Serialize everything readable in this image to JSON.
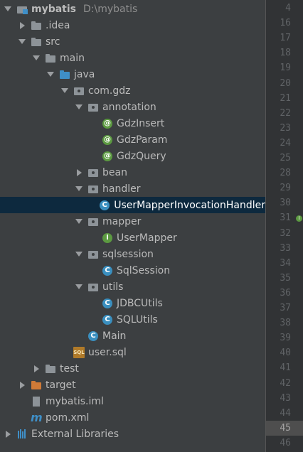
{
  "project_tree": {
    "rows": [
      {
        "label": "mybatis",
        "path": "D:\\mybatis",
        "expanded": true,
        "icon": "module-icon"
      },
      {
        "label": ".idea",
        "expanded": false,
        "icon": "folder-icon"
      },
      {
        "label": "src",
        "expanded": true,
        "icon": "folder-icon"
      },
      {
        "label": "main",
        "expanded": true,
        "icon": "folder-icon"
      },
      {
        "label": "java",
        "expanded": true,
        "icon": "folder-blue-icon"
      },
      {
        "label": "com.gdz",
        "expanded": true,
        "icon": "package-icon"
      },
      {
        "label": "annotation",
        "expanded": true,
        "icon": "package-icon"
      },
      {
        "label": "GdzInsert",
        "icon": "annotation-icon"
      },
      {
        "label": "GdzParam",
        "icon": "annotation-icon"
      },
      {
        "label": "GdzQuery",
        "icon": "annotation-icon"
      },
      {
        "label": "bean",
        "expanded": false,
        "icon": "package-icon"
      },
      {
        "label": "handler",
        "expanded": true,
        "icon": "package-icon"
      },
      {
        "label": "UserMapperInvocationHandler",
        "icon": "class-icon",
        "selected": true
      },
      {
        "label": "mapper",
        "expanded": true,
        "icon": "package-icon"
      },
      {
        "label": "UserMapper",
        "icon": "interface-icon"
      },
      {
        "label": "sqlsession",
        "expanded": true,
        "icon": "package-icon"
      },
      {
        "label": "SqlSession",
        "icon": "class-icon"
      },
      {
        "label": "utils",
        "expanded": true,
        "icon": "package-icon"
      },
      {
        "label": "JDBCUtils",
        "icon": "class-icon"
      },
      {
        "label": "SQLUtils",
        "icon": "class-icon"
      },
      {
        "label": "Main",
        "icon": "class-icon"
      },
      {
        "label": "user.sql",
        "icon": "sql-icon"
      },
      {
        "label": "test",
        "expanded": false,
        "icon": "folder-icon"
      },
      {
        "label": "target",
        "expanded": false,
        "icon": "folder-orange-icon"
      },
      {
        "label": "mybatis.iml",
        "icon": "iml-icon"
      },
      {
        "label": "pom.xml",
        "icon": "maven-icon"
      },
      {
        "label": "External Libraries",
        "expanded": false,
        "icon": "libraries-icon"
      }
    ]
  },
  "gutter": {
    "line_numbers": [
      "4",
      "16",
      "17",
      "18",
      "19",
      "20",
      "21",
      "22",
      "23",
      "24",
      "25",
      "28",
      "29",
      "30",
      "31",
      "32",
      "33",
      "34",
      "35",
      "36",
      "37",
      "38",
      "39",
      "40",
      "41",
      "42",
      "43",
      "44",
      "45",
      "46"
    ],
    "current_line": "45",
    "implements_marker_line": "31",
    "marker_glyph": "I"
  },
  "colors": {
    "tree_bg": "#3c3f41",
    "selected_bg": "#0d293e",
    "gutter_bg": "#313335",
    "text": "#bbbbbb"
  }
}
